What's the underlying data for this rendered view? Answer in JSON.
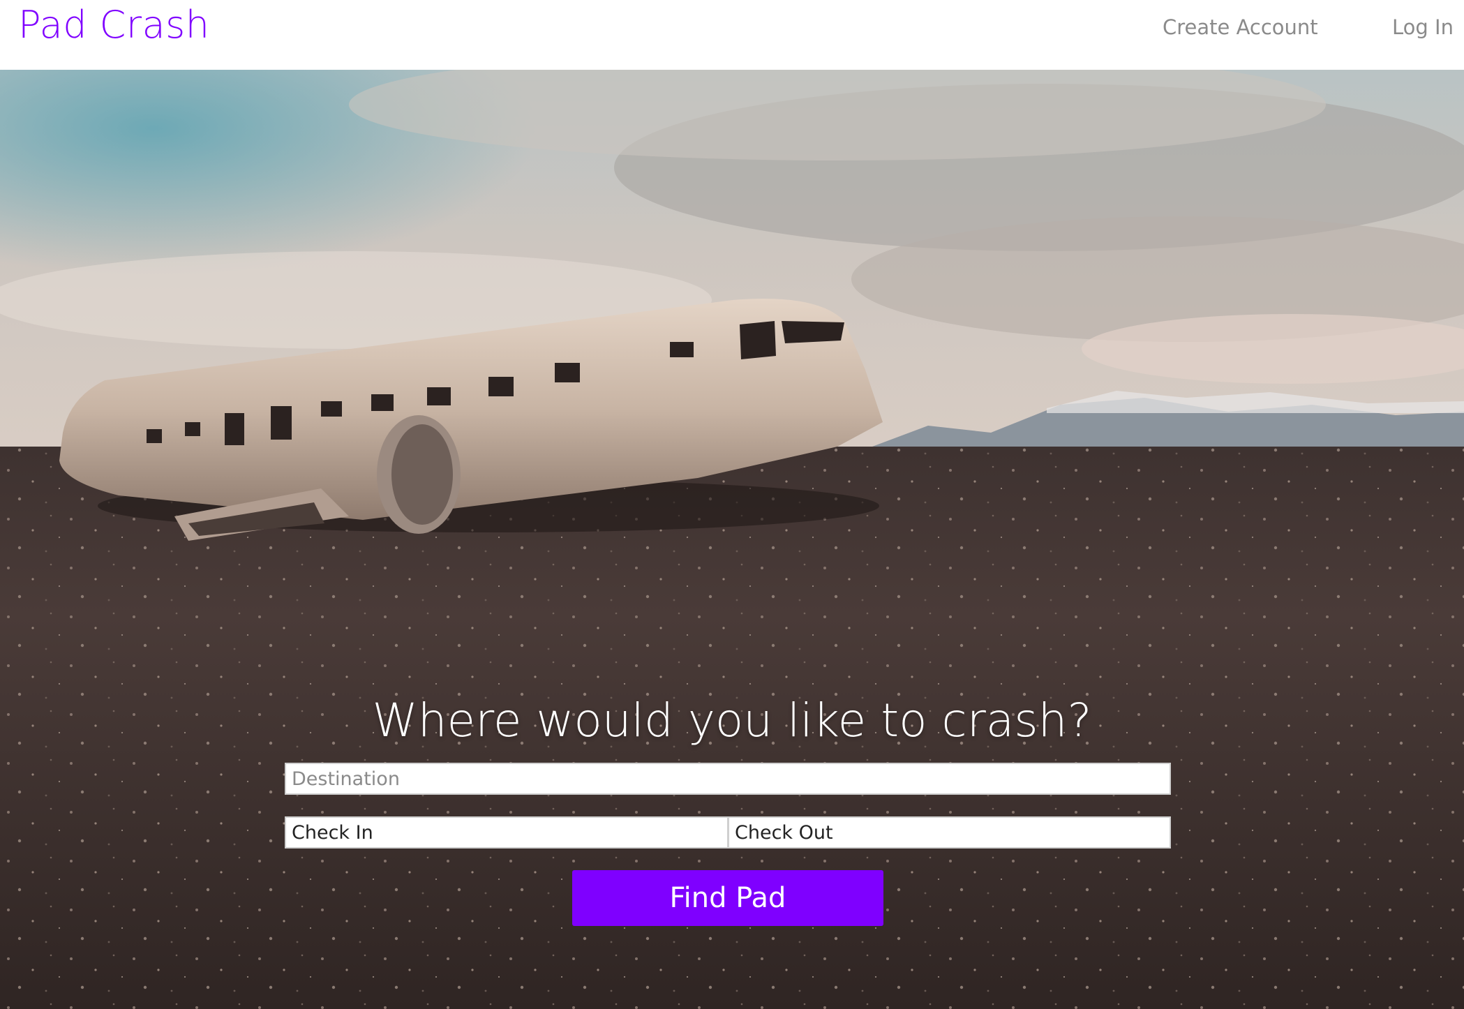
{
  "brand": {
    "name": "Pad Crash",
    "color": "#7f00ff"
  },
  "nav": {
    "create_account": "Create Account",
    "log_in": "Log In",
    "link_color": "#8a8a8a"
  },
  "hero": {
    "background": "crashed-plane-photo",
    "headline": "Where would you like to crash?"
  },
  "search": {
    "destination_placeholder": "Destination",
    "check_in_placeholder": "Check In",
    "check_out_placeholder": "Check Out",
    "submit_label": "Find Pad",
    "button_color": "#7f00ff"
  }
}
